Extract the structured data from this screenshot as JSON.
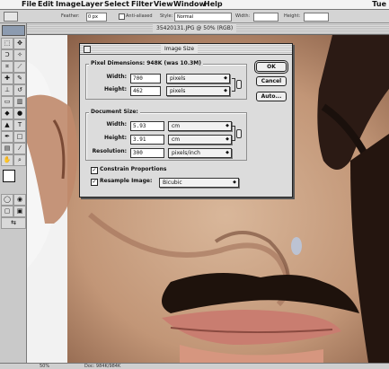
{
  "menubar": {
    "apple": "",
    "items": [
      "File",
      "Edit",
      "Image",
      "Layer",
      "Select",
      "Filter",
      "View",
      "Window",
      "Help"
    ],
    "clock": "Tue"
  },
  "optbar": {
    "feather_label": "Feather:",
    "feather_value": "0 px",
    "antialias_label": "Anti-aliased",
    "style_label": "Style:",
    "style_value": "Normal",
    "width_label": "Width:",
    "height_label": "Height:"
  },
  "document": {
    "title": "35420131.JPG @ 50% (RGB)"
  },
  "status": {
    "zoom": "50%",
    "doc_size": "Doc: 984K/984K"
  },
  "dialog": {
    "title": "Image Size",
    "pixel_group_label": "Pixel Dimensions: 948K (was 10.3M)",
    "px_width_label": "Width:",
    "px_width_value": "700",
    "px_width_unit": "pixels",
    "px_height_label": "Height:",
    "px_height_value": "462",
    "px_height_unit": "pixels",
    "doc_group_label": "Document Size:",
    "doc_width_label": "Width:",
    "doc_width_value": "5.93",
    "doc_width_unit": "cm",
    "doc_height_label": "Height:",
    "doc_height_value": "3.91",
    "doc_height_unit": "cm",
    "resolution_label": "Resolution:",
    "resolution_value": "300",
    "resolution_unit": "pixels/inch",
    "constrain_label": "Constrain Proportions",
    "constrain_checked": true,
    "resample_label": "Resample Image:",
    "resample_checked": true,
    "resample_method": "Bicubic",
    "ok_label": "OK",
    "cancel_label": "Cancel",
    "auto_label": "Auto...",
    "check_mark": "✓"
  }
}
